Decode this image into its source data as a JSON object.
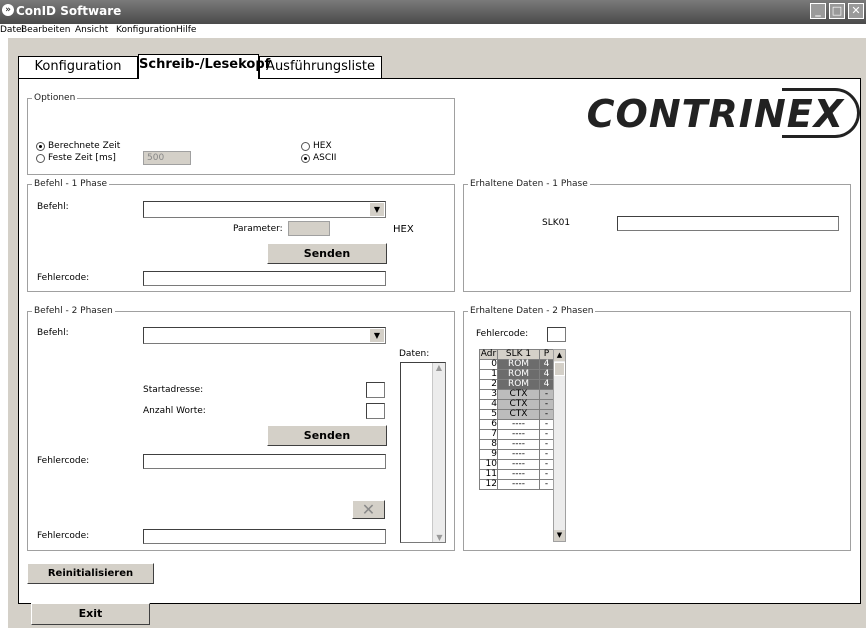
{
  "window": {
    "title": "ConID Software",
    "minimize": "_",
    "maximize": "□",
    "close": "✕"
  },
  "menu": [
    "Datei",
    "Bearbeiten",
    "Ansicht",
    "Konfiguration",
    "Hilfe"
  ],
  "tabs": [
    "Konfiguration",
    "Schreib-/Lesekopf",
    "Ausführungsliste"
  ],
  "logo": "CONTRINEX",
  "optionen": {
    "legend": "Optionen",
    "radio1": "Berechnete Zeit",
    "radio2": "Feste Zeit [ms]",
    "feste_zeit_value": "500",
    "radio_hex": "HEX",
    "radio_ascii": "ASCII"
  },
  "phase1": {
    "legend": "Befehl - 1 Phase",
    "befehl_label": "Befehl:",
    "parameter_label": "Parameter:",
    "hex_label": "HEX",
    "senden": "Senden",
    "fehlercode_label": "Fehlercode:"
  },
  "recv1": {
    "legend": "Erhaltene Daten - 1 Phase",
    "slk_label": "SLK01"
  },
  "phase2": {
    "legend": "Befehl - 2 Phasen",
    "befehl_label": "Befehl:",
    "daten_label": "Daten:",
    "startadresse_label": "Startadresse:",
    "anzahl_label": "Anzahl Worte:",
    "senden": "Senden",
    "fehlercode1_label": "Fehlercode:",
    "fehlercode2_label": "Fehlercode:",
    "clear_icon": "✕"
  },
  "recv2": {
    "legend": "Erhaltene Daten - 2 Phasen",
    "fehlercode_label": "Fehlercode:",
    "columns": [
      "Adr",
      "SLK 1",
      "P"
    ],
    "rows": [
      {
        "adr": "0",
        "slk": "ROM",
        "p": "4",
        "kind": "rom"
      },
      {
        "adr": "1",
        "slk": "ROM",
        "p": "4",
        "kind": "rom"
      },
      {
        "adr": "2",
        "slk": "ROM",
        "p": "4",
        "kind": "rom"
      },
      {
        "adr": "3",
        "slk": "CTX",
        "p": "-",
        "kind": "ctx"
      },
      {
        "adr": "4",
        "slk": "CTX",
        "p": "-",
        "kind": "ctx"
      },
      {
        "adr": "5",
        "slk": "CTX",
        "p": "-",
        "kind": "ctx"
      },
      {
        "adr": "6",
        "slk": "----",
        "p": "-",
        "kind": "empty"
      },
      {
        "adr": "7",
        "slk": "----",
        "p": "-",
        "kind": "empty"
      },
      {
        "adr": "8",
        "slk": "----",
        "p": "-",
        "kind": "empty"
      },
      {
        "adr": "9",
        "slk": "----",
        "p": "-",
        "kind": "empty"
      },
      {
        "adr": "10",
        "slk": "----",
        "p": "-",
        "kind": "empty"
      },
      {
        "adr": "11",
        "slk": "----",
        "p": "-",
        "kind": "empty"
      },
      {
        "adr": "12",
        "slk": "----",
        "p": "-",
        "kind": "empty"
      }
    ]
  },
  "buttons": {
    "reinit": "Reinitialisieren",
    "exit": "Exit"
  }
}
